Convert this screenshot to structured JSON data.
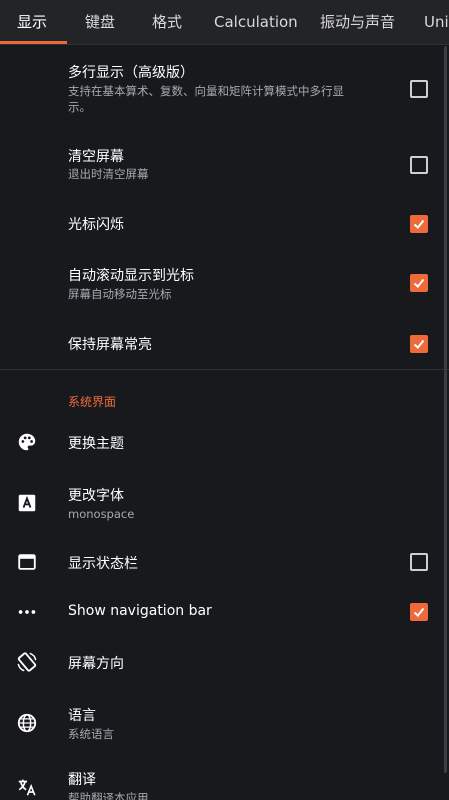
{
  "tabs": [
    {
      "label": "显示",
      "active": true
    },
    {
      "label": "键盘"
    },
    {
      "label": "格式"
    },
    {
      "label": "Calculation"
    },
    {
      "label": "振动与声音"
    },
    {
      "label": "Uni"
    }
  ],
  "settings": [
    {
      "title": "多行显示（高级版）",
      "subtitle_lines": [
        "支持在基本算术、复数、向量和矩阵计算模式中多行显",
        "示。"
      ],
      "checked": false
    },
    {
      "title": "清空屏幕",
      "subtitle": "退出时清空屏幕",
      "checked": false
    },
    {
      "title": "光标闪烁",
      "checked": true
    },
    {
      "title": "自动滚动显示到光标",
      "subtitle": "屏幕自动移动至光标",
      "checked": true
    },
    {
      "title": "保持屏幕常亮",
      "checked": true
    }
  ],
  "system_section": {
    "header": "系统界面",
    "items": [
      {
        "icon": "palette-icon",
        "title": "更换主题"
      },
      {
        "icon": "font-icon",
        "title": "更改字体",
        "subtitle": "monospace"
      },
      {
        "icon": "window-icon",
        "title": "显示状态栏",
        "checked": false
      },
      {
        "icon": "more-horiz-icon",
        "title": "Show navigation bar",
        "checked": true
      },
      {
        "icon": "screen-rotation-icon",
        "title": "屏幕方向"
      },
      {
        "icon": "globe-icon",
        "title": "语言",
        "subtitle": "系统语言"
      },
      {
        "icon": "translate-icon",
        "title": "翻译",
        "subtitle": "帮助翻译本应用"
      }
    ]
  },
  "colors": {
    "accent": "#ef6a3a",
    "background": "#17191d",
    "tabbar": "#222428"
  }
}
